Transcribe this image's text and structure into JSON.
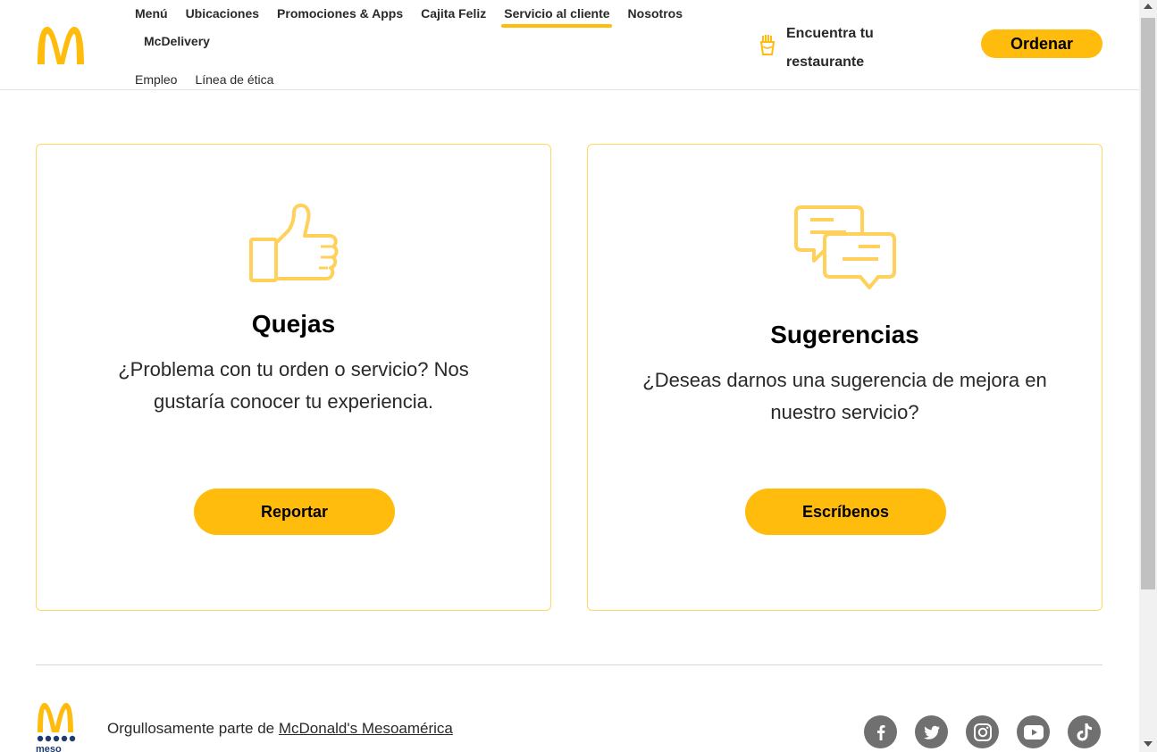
{
  "header": {
    "nav": [
      "Menú",
      "Ubicaciones",
      "Promociones & Apps",
      "Cajita Feliz",
      "Servicio al cliente",
      "Nosotros"
    ],
    "nav_row2": "McDelivery",
    "sub_nav": [
      "Empleo",
      "Línea de ética"
    ],
    "find_restaurant": "Encuentra tu restaurante",
    "order_label": "Ordenar",
    "brand_color": "#ffbc0d"
  },
  "cards": [
    {
      "title": "Quejas",
      "description": "¿Problema con tu orden o servicio? Nos gustaría conocer tu experiencia.",
      "button": "Reportar",
      "icon": "thumbs-up-icon"
    },
    {
      "title": "Sugerencias",
      "description": "¿Deseas darnos una sugerencia de mejora en nuestro servicio?",
      "button": "Escríbenos",
      "icon": "chat-bubbles-icon"
    }
  ],
  "footer": {
    "text": "Orgullosamente parte de",
    "link": "McDonald's Mesoamérica",
    "logo_text": "meso",
    "socials": [
      "facebook-icon",
      "twitter-icon",
      "instagram-icon",
      "youtube-icon",
      "tiktok-icon"
    ]
  }
}
